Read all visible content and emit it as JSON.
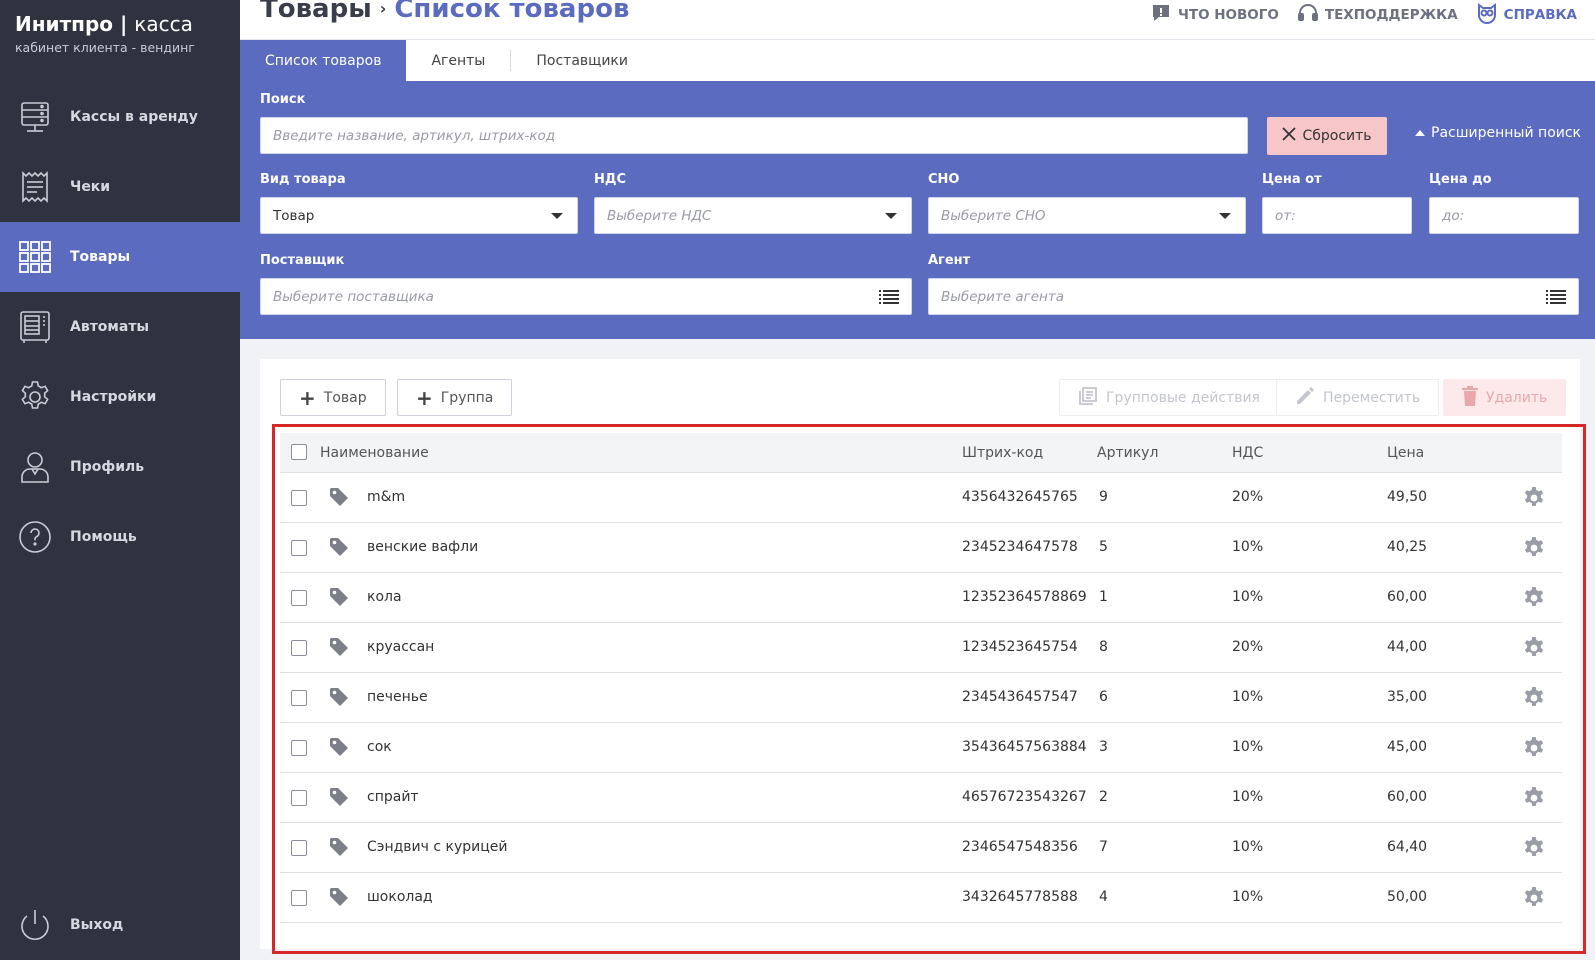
{
  "brand": {
    "title_bold": "Инитпро",
    "divider": "|",
    "title_light": "касса",
    "subtitle": "кабинет клиента - вендинг"
  },
  "sidebar": {
    "items": [
      {
        "label": "Кассы в аренду",
        "icon": "server-icon"
      },
      {
        "label": "Чеки",
        "icon": "receipt-icon"
      },
      {
        "label": "Товары",
        "icon": "grid-icon",
        "active": true
      },
      {
        "label": "Автоматы",
        "icon": "vending-machine-icon"
      },
      {
        "label": "Настройки",
        "icon": "gear-icon"
      },
      {
        "label": "Профиль",
        "icon": "user-icon"
      },
      {
        "label": "Помощь",
        "icon": "help-icon"
      }
    ],
    "exit_label": "Выход"
  },
  "header": {
    "title": "Товары",
    "separator": "›",
    "subtitle": "Список товаров",
    "links": {
      "whats_new": "ЧТО НОВОГО",
      "support": "ТЕХПОДДЕРЖКА",
      "help": "СПРАВКА"
    }
  },
  "tabs": [
    "Список товаров",
    "Агенты",
    "Поставщики"
  ],
  "filters": {
    "search_label": "Поиск",
    "search_placeholder": "Введите название, артикул, штрих-код",
    "reset_label": "Сбросить",
    "advanced_label": "Расширенный поиск",
    "type_label": "Вид товара",
    "type_value": "Товар",
    "vat_label": "НДС",
    "vat_placeholder": "Выберите НДС",
    "sno_label": "СНО",
    "sno_placeholder": "Выберите СНО",
    "price_from_label": "Цена от",
    "price_from_placeholder": "от:",
    "price_to_label": "Цена до",
    "price_to_placeholder": "до:",
    "supplier_label": "Поставщик",
    "supplier_placeholder": "Выберите поставщика",
    "agent_label": "Агент",
    "agent_placeholder": "Выберите агента"
  },
  "toolbar": {
    "add_product": "Товар",
    "add_group": "Группа",
    "group_actions": "Групповые действия",
    "move": "Переместить",
    "delete": "Удалить"
  },
  "table": {
    "columns": {
      "name": "Наименование",
      "barcode": "Штрих-код",
      "article": "Артикул",
      "vat": "НДС",
      "price": "Цена"
    },
    "rows": [
      {
        "name": "m&m",
        "barcode": "4356432645765",
        "article": "9",
        "vat": "20%",
        "price": "49,50"
      },
      {
        "name": "венские вафли",
        "barcode": "2345234647578",
        "article": "5",
        "vat": "10%",
        "price": "40,25"
      },
      {
        "name": "кола",
        "barcode": "12352364578869",
        "article": "1",
        "vat": "10%",
        "price": "60,00"
      },
      {
        "name": "круассан",
        "barcode": "1234523645754",
        "article": "8",
        "vat": "20%",
        "price": "44,00"
      },
      {
        "name": "печенье",
        "barcode": "2345436457547",
        "article": "6",
        "vat": "10%",
        "price": "35,00"
      },
      {
        "name": "сок",
        "barcode": "35436457563884",
        "article": "3",
        "vat": "10%",
        "price": "45,00"
      },
      {
        "name": "спрайт",
        "barcode": "46576723543267",
        "article": "2",
        "vat": "10%",
        "price": "60,00"
      },
      {
        "name": "Сэндвич с курицей",
        "barcode": "2346547548356",
        "article": "7",
        "vat": "10%",
        "price": "64,40"
      },
      {
        "name": "шоколад",
        "barcode": "3432645778588",
        "article": "4",
        "vat": "10%",
        "price": "50,00"
      }
    ]
  },
  "colors": {
    "accent": "#5b6bbf",
    "sidebar": "#2f3340",
    "highlight": "#d62828",
    "reset": "#f7c6c8"
  }
}
